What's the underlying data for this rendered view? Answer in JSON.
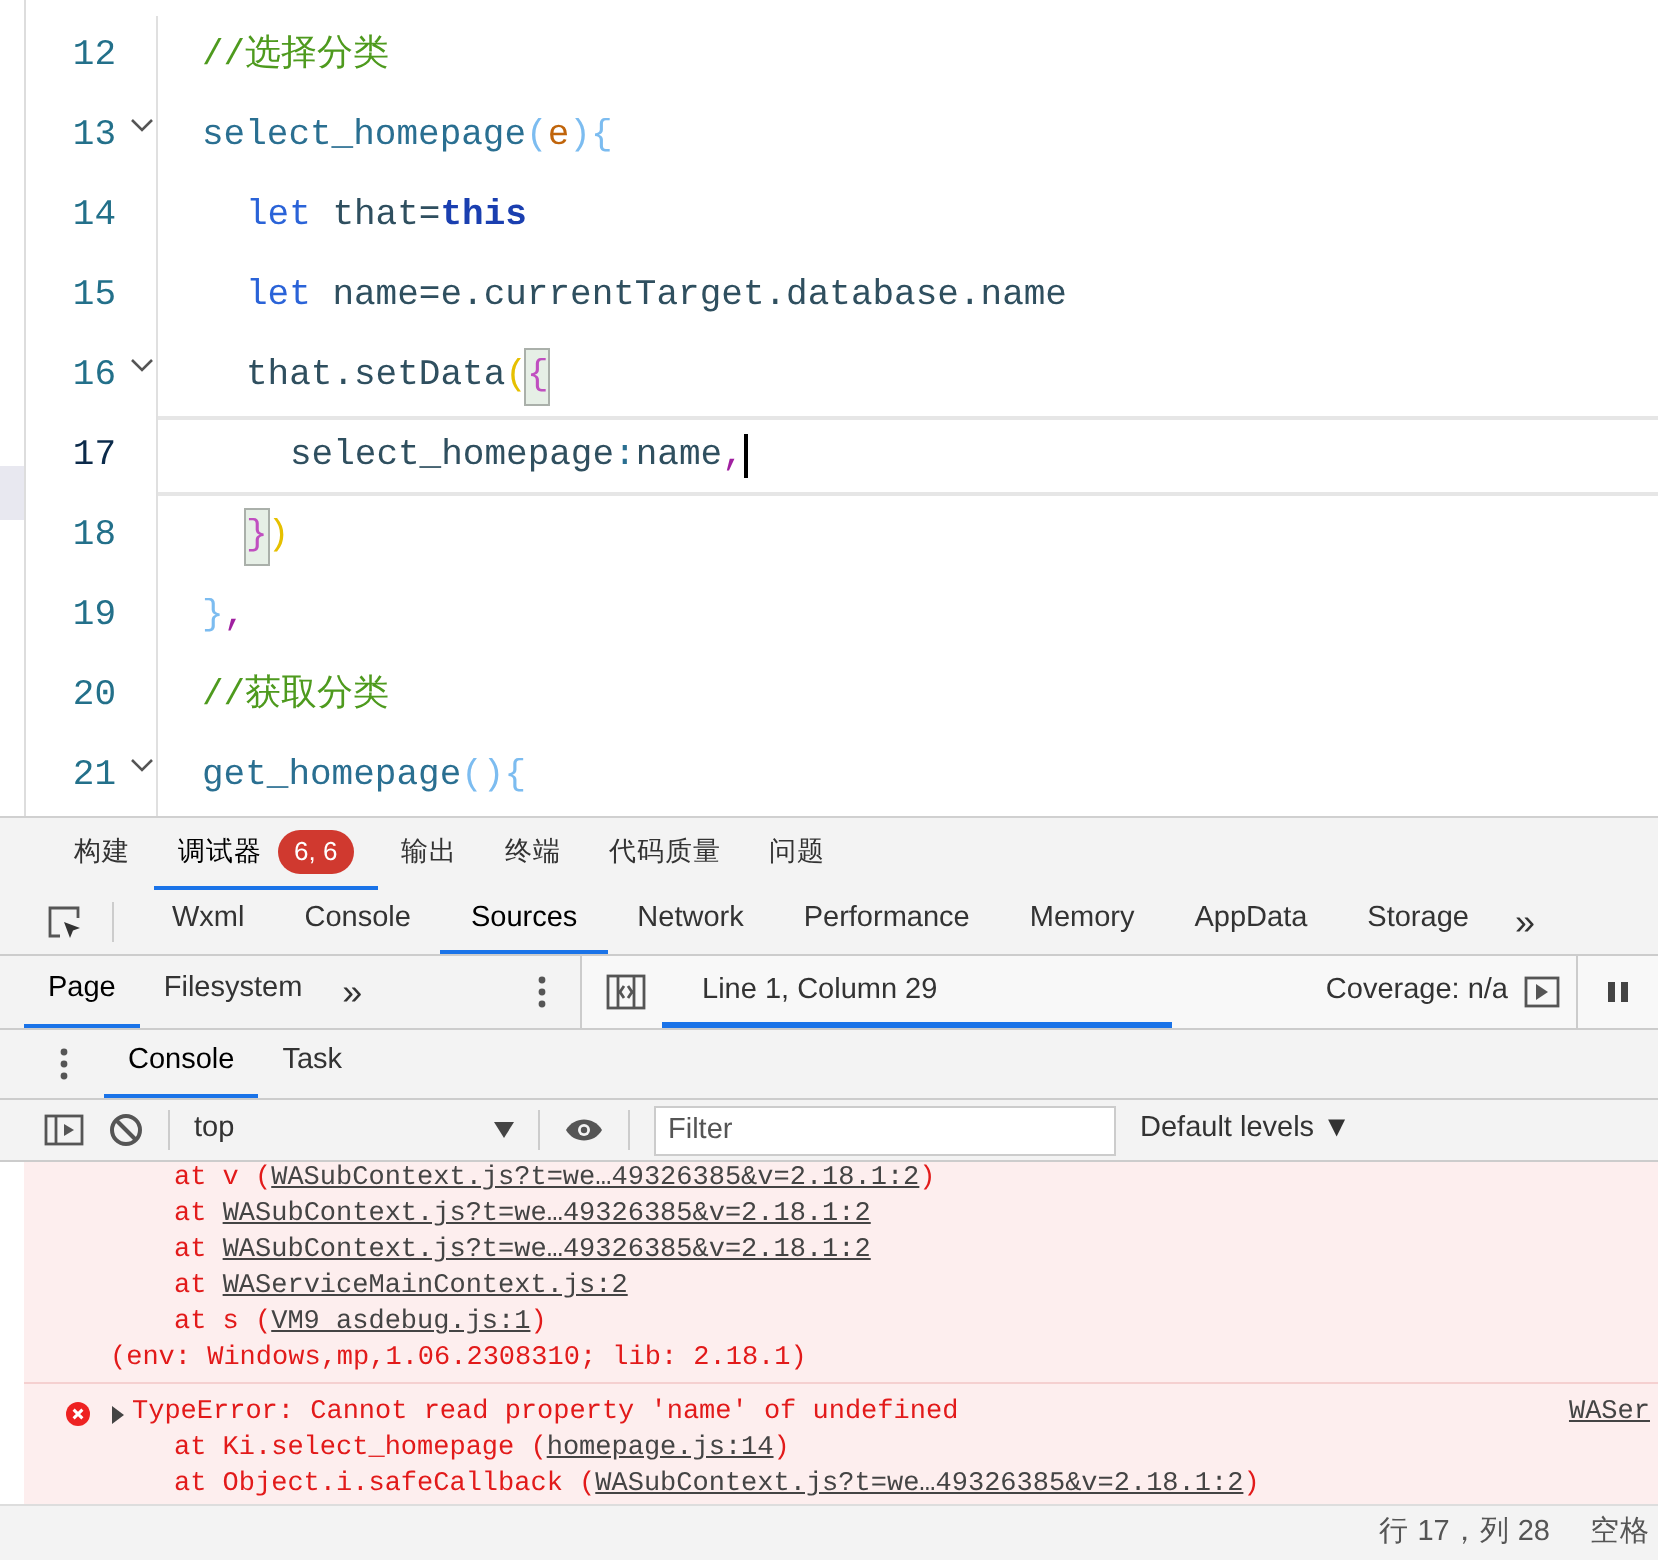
{
  "editor": {
    "lines": [
      {
        "number": "12",
        "fold": false,
        "current": false,
        "tokens": [
          {
            "text": "//选择分类",
            "kind": "comment"
          }
        ]
      },
      {
        "number": "13",
        "fold": true,
        "current": false,
        "tokens": [
          {
            "text": "select_homepage",
            "kind": "ident"
          },
          {
            "text": "(",
            "kind": "paren"
          },
          {
            "text": "e",
            "kind": "param"
          },
          {
            "text": "){",
            "kind": "paren"
          }
        ],
        "children": [
          {
            "number": "14",
            "fold": false,
            "current": false,
            "tokens": [
              {
                "text": "let",
                "kind": "keyword"
              },
              {
                "text": " that=",
                "kind": "plain"
              },
              {
                "text": "this",
                "kind": "this"
              }
            ]
          },
          {
            "number": "15",
            "fold": false,
            "current": false,
            "tokens": [
              {
                "text": "let",
                "kind": "keyword"
              },
              {
                "text": " name=e.currentTarget.database.name",
                "kind": "plain"
              }
            ]
          },
          {
            "number": "16",
            "fold": true,
            "current": false,
            "tokens": [
              {
                "text": "that.setData",
                "kind": "plain"
              },
              {
                "text": "(",
                "kind": "yellow"
              },
              {
                "text": "{",
                "kind": "match"
              }
            ],
            "children": [
              {
                "number": "17",
                "fold": false,
                "current": true,
                "tokens": [
                  {
                    "text": "select_homepage",
                    "kind": "plain"
                  },
                  {
                    "text": ":",
                    "kind": "ident"
                  },
                  {
                    "text": "name",
                    "kind": "plain"
                  },
                  {
                    "text": ",",
                    "kind": "punct"
                  }
                ]
              }
            ]
          },
          {
            "number": "18",
            "fold": false,
            "current": false,
            "tokens": [
              {
                "text": "}",
                "kind": "match"
              },
              {
                "text": ")",
                "kind": "yellow"
              }
            ]
          }
        ]
      },
      {
        "number": "19",
        "fold": false,
        "current": false,
        "tokens": [
          {
            "text": "}",
            "kind": "paren"
          },
          {
            "text": ",",
            "kind": "punct"
          }
        ]
      },
      {
        "number": "20",
        "fold": false,
        "current": false,
        "tokens": [
          {
            "text": "//获取分类",
            "kind": "comment"
          }
        ]
      },
      {
        "number": "21",
        "fold": true,
        "current": false,
        "tokens": [
          {
            "text": "get_homepage",
            "kind": "ident"
          },
          {
            "text": "(){",
            "kind": "paren"
          }
        ]
      }
    ]
  },
  "panel_tabs": [
    {
      "label": "构建",
      "selected": false
    },
    {
      "label": "调试器",
      "selected": true,
      "badge": "6, 6"
    },
    {
      "label": "输出",
      "selected": false
    },
    {
      "label": "终端",
      "selected": false
    },
    {
      "label": "代码质量",
      "selected": false
    },
    {
      "label": "问题",
      "selected": false
    }
  ],
  "devtools_tabs": [
    {
      "label": "Wxml",
      "selected": false
    },
    {
      "label": "Console",
      "selected": false
    },
    {
      "label": "Sources",
      "selected": true
    },
    {
      "label": "Network",
      "selected": false
    },
    {
      "label": "Performance",
      "selected": false
    },
    {
      "label": "Memory",
      "selected": false
    },
    {
      "label": "AppData",
      "selected": false
    },
    {
      "label": "Storage",
      "selected": false
    }
  ],
  "devtools_more": "»",
  "navigator_tabs": [
    {
      "label": "Page",
      "selected": true
    },
    {
      "label": "Filesystem",
      "selected": false
    }
  ],
  "navigator_more": "»",
  "source_status": {
    "position": "Line 1, Column 29",
    "coverage": "Coverage: n/a"
  },
  "drawer_tabs": [
    {
      "label": "Console",
      "selected": true
    },
    {
      "label": "Task",
      "selected": false
    }
  ],
  "console_toolbar": {
    "context": "top",
    "filter_placeholder": "Filter",
    "levels": "Default levels ▼"
  },
  "messages": [
    {
      "kind": "error",
      "lines": [
        [
          {
            "text": "at v (",
            "link": false
          },
          {
            "text": "WASubContext.js?t=we…49326385&v=2.18.1:2",
            "link": true
          },
          {
            "text": ")",
            "link": false
          }
        ],
        [
          {
            "text": "at ",
            "link": false
          },
          {
            "text": "WASubContext.js?t=we…49326385&v=2.18.1:2",
            "link": true
          }
        ],
        [
          {
            "text": "at ",
            "link": false
          },
          {
            "text": "WASubContext.js?t=we…49326385&v=2.18.1:2",
            "link": true
          }
        ],
        [
          {
            "text": "at ",
            "link": false
          },
          {
            "text": "WAServiceMainContext.js:2",
            "link": true
          }
        ],
        [
          {
            "text": "at s (",
            "link": false
          },
          {
            "text": "VM9 asdebug.js:1",
            "link": true
          },
          {
            "text": ")",
            "link": false
          }
        ]
      ],
      "note": "(env: Windows,mp,1.06.2308310; lib: 2.18.1)"
    },
    {
      "kind": "error",
      "expanded": false,
      "header": "TypeError: Cannot read property 'name' of undefined",
      "source": "WASer",
      "lines": [
        [
          {
            "text": "at Ki.select_homepage (",
            "link": false
          },
          {
            "text": "homepage.js:14",
            "link": true
          },
          {
            "text": ")",
            "link": false
          }
        ],
        [
          {
            "text": "at Object.i.safeCallback (",
            "link": false
          },
          {
            "text": "WASubContext.js?t=we…49326385&v=2.18.1:2",
            "link": true
          },
          {
            "text": ")",
            "link": false
          }
        ]
      ]
    }
  ],
  "status_bar": {
    "cursor": "行 17，列 28",
    "indent": "空格"
  }
}
